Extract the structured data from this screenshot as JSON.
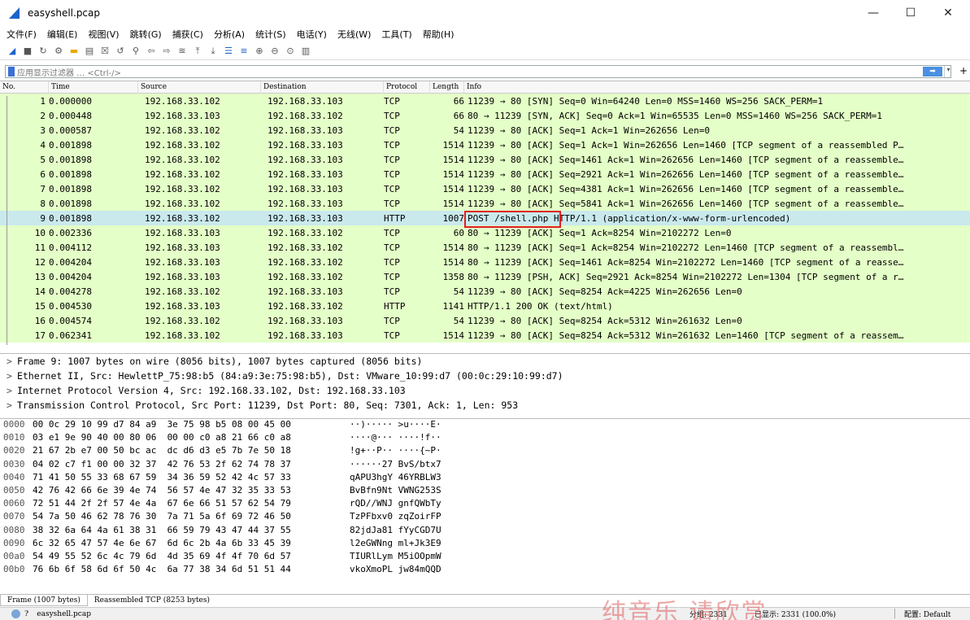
{
  "window": {
    "title": "easyshell.pcap",
    "controls": [
      "—",
      "☐",
      "✕"
    ]
  },
  "menu": [
    "文件(F)",
    "编辑(E)",
    "视图(V)",
    "跳转(G)",
    "捕获(C)",
    "分析(A)",
    "统计(S)",
    "电话(Y)",
    "无线(W)",
    "工具(T)",
    "帮助(H)"
  ],
  "filter": {
    "placeholder": "应用显示过滤器 … <Ctrl-/>",
    "apply_label": "➡"
  },
  "packet_list": {
    "columns": [
      "No.",
      "Time",
      "Source",
      "Destination",
      "Protocol",
      "Length",
      "Info"
    ],
    "rows": [
      {
        "no": "1",
        "time": "0.000000",
        "src": "192.168.33.102",
        "dst": "192.168.33.103",
        "proto": "TCP",
        "len": "66",
        "info": "11239 → 80 [SYN] Seq=0 Win=64240 Len=0 MSS=1460 WS=256 SACK_PERM=1"
      },
      {
        "no": "2",
        "time": "0.000448",
        "src": "192.168.33.103",
        "dst": "192.168.33.102",
        "proto": "TCP",
        "len": "66",
        "info": "80 → 11239 [SYN, ACK] Seq=0 Ack=1 Win=65535 Len=0 MSS=1460 WS=256 SACK_PERM=1"
      },
      {
        "no": "3",
        "time": "0.000587",
        "src": "192.168.33.102",
        "dst": "192.168.33.103",
        "proto": "TCP",
        "len": "54",
        "info": "11239 → 80 [ACK] Seq=1 Ack=1 Win=262656 Len=0"
      },
      {
        "no": "4",
        "time": "0.001898",
        "src": "192.168.33.102",
        "dst": "192.168.33.103",
        "proto": "TCP",
        "len": "1514",
        "info": "11239 → 80 [ACK] Seq=1 Ack=1 Win=262656 Len=1460 [TCP segment of a reassembled P…"
      },
      {
        "no": "5",
        "time": "0.001898",
        "src": "192.168.33.102",
        "dst": "192.168.33.103",
        "proto": "TCP",
        "len": "1514",
        "info": "11239 → 80 [ACK] Seq=1461 Ack=1 Win=262656 Len=1460 [TCP segment of a reassemble…"
      },
      {
        "no": "6",
        "time": "0.001898",
        "src": "192.168.33.102",
        "dst": "192.168.33.103",
        "proto": "TCP",
        "len": "1514",
        "info": "11239 → 80 [ACK] Seq=2921 Ack=1 Win=262656 Len=1460 [TCP segment of a reassemble…"
      },
      {
        "no": "7",
        "time": "0.001898",
        "src": "192.168.33.102",
        "dst": "192.168.33.103",
        "proto": "TCP",
        "len": "1514",
        "info": "11239 → 80 [ACK] Seq=4381 Ack=1 Win=262656 Len=1460 [TCP segment of a reassemble…"
      },
      {
        "no": "8",
        "time": "0.001898",
        "src": "192.168.33.102",
        "dst": "192.168.33.103",
        "proto": "TCP",
        "len": "1514",
        "info": "11239 → 80 [ACK] Seq=5841 Ack=1 Win=262656 Len=1460 [TCP segment of a reassemble…"
      },
      {
        "no": "9",
        "time": "0.001898",
        "src": "192.168.33.102",
        "dst": "192.168.33.103",
        "proto": "HTTP",
        "len": "1007",
        "info": "POST /shell.php HTTP/1.1  (application/x-www-form-urlencoded)"
      },
      {
        "no": "10",
        "time": "0.002336",
        "src": "192.168.33.103",
        "dst": "192.168.33.102",
        "proto": "TCP",
        "len": "60",
        "info": "80 → 11239 [ACK] Seq=1 Ack=8254 Win=2102272 Len=0"
      },
      {
        "no": "11",
        "time": "0.004112",
        "src": "192.168.33.103",
        "dst": "192.168.33.102",
        "proto": "TCP",
        "len": "1514",
        "info": "80 → 11239 [ACK] Seq=1 Ack=8254 Win=2102272 Len=1460 [TCP segment of a reassembl…"
      },
      {
        "no": "12",
        "time": "0.004204",
        "src": "192.168.33.103",
        "dst": "192.168.33.102",
        "proto": "TCP",
        "len": "1514",
        "info": "80 → 11239 [ACK] Seq=1461 Ack=8254 Win=2102272 Len=1460 [TCP segment of a reasse…"
      },
      {
        "no": "13",
        "time": "0.004204",
        "src": "192.168.33.103",
        "dst": "192.168.33.102",
        "proto": "TCP",
        "len": "1358",
        "info": "80 → 11239 [PSH, ACK] Seq=2921 Ack=8254 Win=2102272 Len=1304 [TCP segment of a r…"
      },
      {
        "no": "14",
        "time": "0.004278",
        "src": "192.168.33.102",
        "dst": "192.168.33.103",
        "proto": "TCP",
        "len": "54",
        "info": "11239 → 80 [ACK] Seq=8254 Ack=4225 Win=262656 Len=0"
      },
      {
        "no": "15",
        "time": "0.004530",
        "src": "192.168.33.103",
        "dst": "192.168.33.102",
        "proto": "HTTP",
        "len": "1141",
        "info": "HTTP/1.1 200 OK  (text/html)"
      },
      {
        "no": "16",
        "time": "0.004574",
        "src": "192.168.33.102",
        "dst": "192.168.33.103",
        "proto": "TCP",
        "len": "54",
        "info": "11239 → 80 [ACK] Seq=8254 Ack=5312 Win=261632 Len=0"
      },
      {
        "no": "17",
        "time": "0.062341",
        "src": "192.168.33.102",
        "dst": "192.168.33.103",
        "proto": "TCP",
        "len": "1514",
        "info": "11239 → 80 [ACK] Seq=8254 Ack=5312 Win=261632 Len=1460 [TCP segment of a reassem…"
      }
    ],
    "selected_no": "9"
  },
  "details": [
    "Frame 9: 1007 bytes on wire (8056 bits), 1007 bytes captured (8056 bits)",
    "Ethernet II, Src: HewlettP_75:98:b5 (84:a9:3e:75:98:b5), Dst: VMware_10:99:d7 (00:0c:29:10:99:d7)",
    "Internet Protocol Version 4, Src: 192.168.33.102, Dst: 192.168.33.103",
    "Transmission Control Protocol, Src Port: 11239, Dst Port: 80, Seq: 7301, Ack: 1, Len: 953"
  ],
  "bytes": [
    {
      "off": "0000",
      "hex": "00 0c 29 10 99 d7 84 a9  3e 75 98 b5 08 00 45 00",
      "ascii": "··)····· >u····E·"
    },
    {
      "off": "0010",
      "hex": "03 e1 9e 90 40 00 80 06  00 00 c0 a8 21 66 c0 a8",
      "ascii": "····@··· ····!f··"
    },
    {
      "off": "0020",
      "hex": "21 67 2b e7 00 50 bc ac  dc d6 d3 e5 7b 7e 50 18",
      "ascii": "!g+··P·· ····{~P·"
    },
    {
      "off": "0030",
      "hex": "04 02 c7 f1 00 00 32 37  42 76 53 2f 62 74 78 37",
      "ascii": "······27 BvS/btx7"
    },
    {
      "off": "0040",
      "hex": "71 41 50 55 33 68 67 59  34 36 59 52 42 4c 57 33",
      "ascii": "qAPU3hgY 46YRBLW3"
    },
    {
      "off": "0050",
      "hex": "42 76 42 66 6e 39 4e 74  56 57 4e 47 32 35 33 53",
      "ascii": "BvBfn9Nt VWNG253S"
    },
    {
      "off": "0060",
      "hex": "72 51 44 2f 2f 57 4e 4a  67 6e 66 51 57 62 54 79",
      "ascii": "rQD//WNJ gnfQWbTy"
    },
    {
      "off": "0070",
      "hex": "54 7a 50 46 62 78 76 30  7a 71 5a 6f 69 72 46 50",
      "ascii": "TzPFbxv0 zqZoirFP"
    },
    {
      "off": "0080",
      "hex": "38 32 6a 64 4a 61 38 31  66 59 79 43 47 44 37 55",
      "ascii": "82jdJa81 fYyCGD7U"
    },
    {
      "off": "0090",
      "hex": "6c 32 65 47 57 4e 6e 67  6d 6c 2b 4a 6b 33 45 39",
      "ascii": "l2eGWNng ml+Jk3E9"
    },
    {
      "off": "00a0",
      "hex": "54 49 55 52 6c 4c 79 6d  4d 35 69 4f 4f 70 6d 57",
      "ascii": "TIURlLym M5iOOpmW"
    },
    {
      "off": "00b0",
      "hex": "76 6b 6f 58 6d 6f 50 4c  6a 77 38 34 6d 51 51 44",
      "ascii": "vkoXmoPL jw84mQQD"
    }
  ],
  "byte_tabs": [
    "Frame (1007 bytes)",
    "Reassembled TCP (8253 bytes)"
  ],
  "status": {
    "file": "easyshell.pcap",
    "packets_text": "分组: 2331",
    "displayed_text": "已显示: 2331 (100.0%)",
    "profile": "配置: Default"
  },
  "watermark": "纯音乐  请欣赏",
  "colors": {
    "tcp_row": "#e4ffc7",
    "selected_row": "#c9e9ed",
    "highlight": "#e02020"
  }
}
